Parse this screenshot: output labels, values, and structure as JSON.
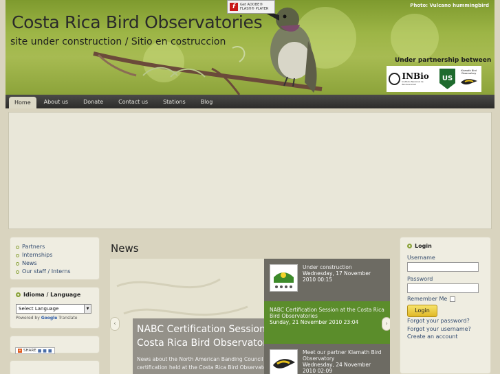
{
  "header": {
    "title": "Costa Rica Bird Observatories",
    "subtitle": "site under construction / Sitio en costruccion",
    "photo_credit": "Photo: Vulcano hummingbird",
    "flash_badge": "Get ADOBE® FLASH® PLAYER",
    "partnership": "Under partnership between",
    "logo_inbio": "INBio",
    "logo_inbio_sub": "Instituto Nacional de Biodiversidad",
    "logo_us": "US",
    "logo_klamath": "Klamath Bird Observatory"
  },
  "nav": {
    "items": [
      "Home",
      "About us",
      "Donate",
      "Contact us",
      "Stations",
      "Blog"
    ],
    "active": "Home"
  },
  "sidebar": {
    "links": [
      "Partners",
      "Internships",
      "News",
      "Our staff / Interns"
    ],
    "language": {
      "title": "Idioma / Language",
      "select_value": "Select Language",
      "powered": "Powered by",
      "google": "Google",
      "translate": "Translate"
    },
    "share_label": "SHARE"
  },
  "news": {
    "title": "News",
    "feature": {
      "headline_line1": "NABC Certification Session at the",
      "headline_line2": "Costa Rica Bird Observatories",
      "desc_line1": "News about the North American Banding Council",
      "desc_line2": "certification held at the Costa Rica Bird Observatories"
    },
    "items": [
      {
        "title": "Under construction",
        "date": "Wednesday, 17 November 2010 00:15"
      },
      {
        "title": "NABC Certification Session at the Costa Rica Bird Observatories",
        "date": "Sunday, 21 November 2010 23:04"
      },
      {
        "title": "Meet our partner Klamath Bird Observatory",
        "date": "Wednesday, 24 November 2010 02:09"
      }
    ],
    "prev_icon": "chevron-left-icon",
    "next_icon": "chevron-right-icon"
  },
  "login": {
    "title": "Login",
    "username_label": "Username",
    "password_label": "Password",
    "remember_label": "Remember Me",
    "button": "Login",
    "forgot_password": "Forgot your password?",
    "forgot_username": "Forgot your username?",
    "create_account": "Create an account"
  },
  "colors": {
    "accent_green": "#8aa239",
    "nav_bg": "#2c2c2a",
    "news_highlight": "#5b8d2b",
    "login_button": "#e0b828"
  }
}
